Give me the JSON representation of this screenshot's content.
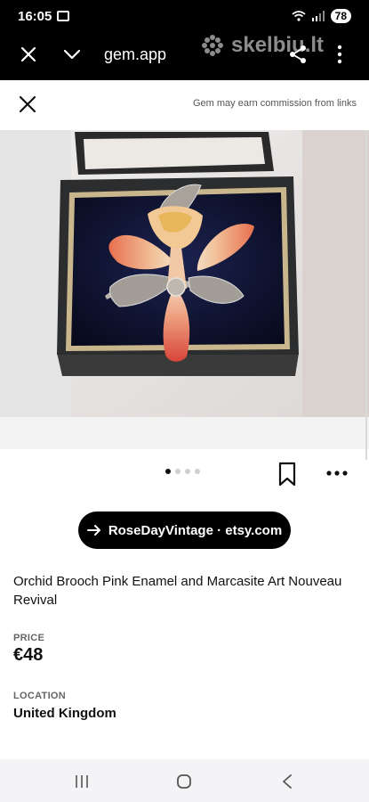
{
  "status_bar": {
    "time": "16:05",
    "battery": "78"
  },
  "browser": {
    "url": "gem.app",
    "watermark": "skelbiu.lt"
  },
  "sheet": {
    "commission_note": "Gem may earn commission from links"
  },
  "product": {
    "image_dots": 4,
    "active_dot": 0,
    "store_button": "RoseDayVintage · etsy.com",
    "title": "Orchid Brooch Pink Enamel and Marcasite Art Nouveau Revival",
    "price_label": "PRICE",
    "price": "€48",
    "location_label": "LOCATION",
    "location": "United Kingdom"
  },
  "icons": {
    "browser": [
      "close-icon",
      "chevron-down-icon",
      "share-icon",
      "more-vertical-icon"
    ],
    "sheet": [
      "close-icon"
    ],
    "actions": [
      "bookmark-icon",
      "more-horizontal-icon"
    ],
    "store": [
      "arrow-right-icon"
    ],
    "nav": [
      "recent-apps-icon",
      "home-icon",
      "back-icon"
    ]
  },
  "colors": {
    "background": "#ffffff",
    "chrome": "#000000",
    "button": "#000000",
    "nav_bar": "#f4f4f6"
  }
}
